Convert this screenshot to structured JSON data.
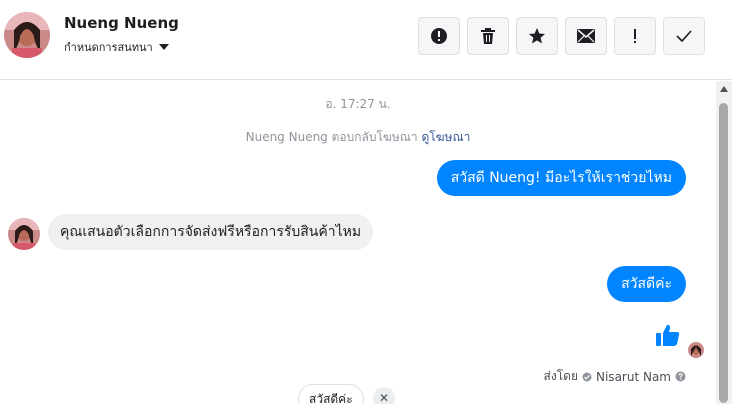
{
  "header": {
    "contact_name": "Nueng Nueng",
    "manage_label": "กำหนดการสนทนา",
    "toolbar": [
      {
        "name": "report-button",
        "icon": "exclamation-circle-icon"
      },
      {
        "name": "delete-button",
        "icon": "trash-icon"
      },
      {
        "name": "star-button",
        "icon": "star-icon"
      },
      {
        "name": "mark-unread-button",
        "icon": "envelope-icon"
      },
      {
        "name": "follow-up-button",
        "icon": "exclamation-icon"
      },
      {
        "name": "done-button",
        "icon": "check-icon"
      }
    ]
  },
  "conversation": {
    "timestamp": "อ. 17:27 น.",
    "system_message": "Nueng Nueng ตอบกลับโฆษณา",
    "system_link": "ดูโฆษณา",
    "messages": [
      {
        "direction": "out",
        "text": "สวัสดี Nueng! มีอะไรให้เราช่วยไหม"
      },
      {
        "direction": "in",
        "text": "คุณเสนอตัวเลือกการจัดส่งฟรีหรือการรับสินค้าไหม"
      },
      {
        "direction": "out",
        "text": "สวัสดีค่ะ"
      }
    ],
    "sent_by_label": "ส่งโดย",
    "sent_by_name": "Nisarut Nam"
  },
  "quick_reply": {
    "chip_label": "สวัสดีค่ะ",
    "close_glyph": "✕"
  },
  "colors": {
    "accent": "#0084ff",
    "incoming_bubble": "#f1f0f0",
    "border": "#dddfe2"
  }
}
